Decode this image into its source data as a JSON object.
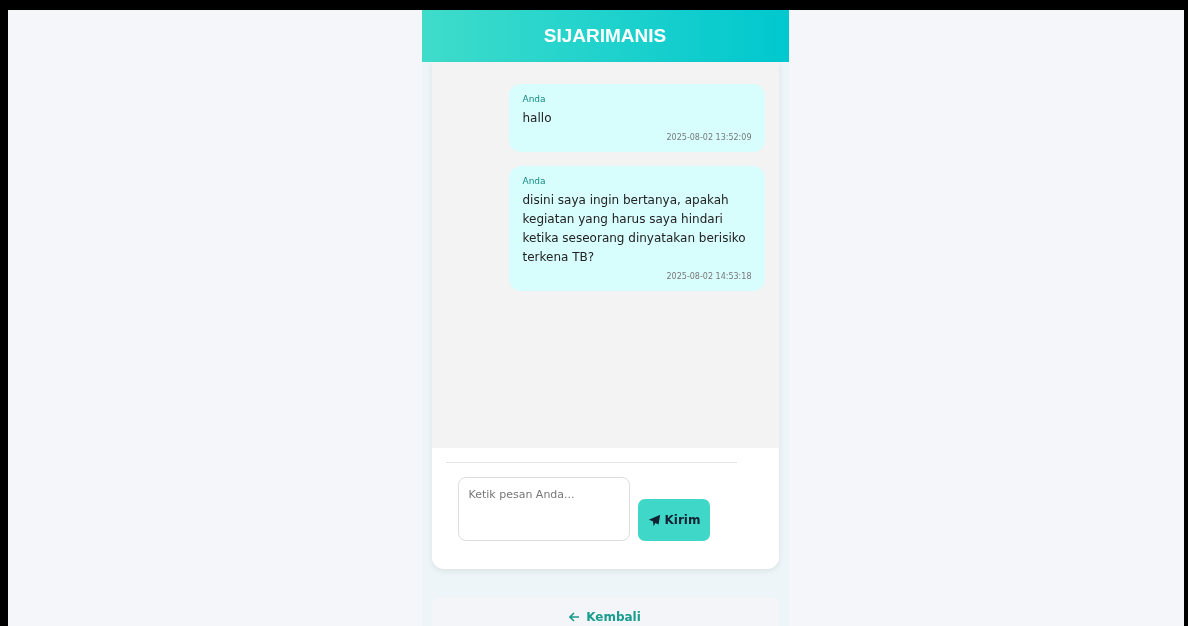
{
  "header": {
    "title": "SIJARIMANIS"
  },
  "messages": [
    {
      "sender": "Anda",
      "text": "hallo",
      "time": "2025-08-02 13:52:09"
    },
    {
      "sender": "Anda",
      "text": "disini saya ingin bertanya, apakah kegiatan yang harus saya hindari ketika seseorang dinyatakan berisiko terkena TB?",
      "time": "2025-08-02 14:53:18"
    }
  ],
  "composer": {
    "placeholder": "Ketik pesan Anda...",
    "send_label": "Kirim"
  },
  "back_link": {
    "label": "Kembali"
  }
}
